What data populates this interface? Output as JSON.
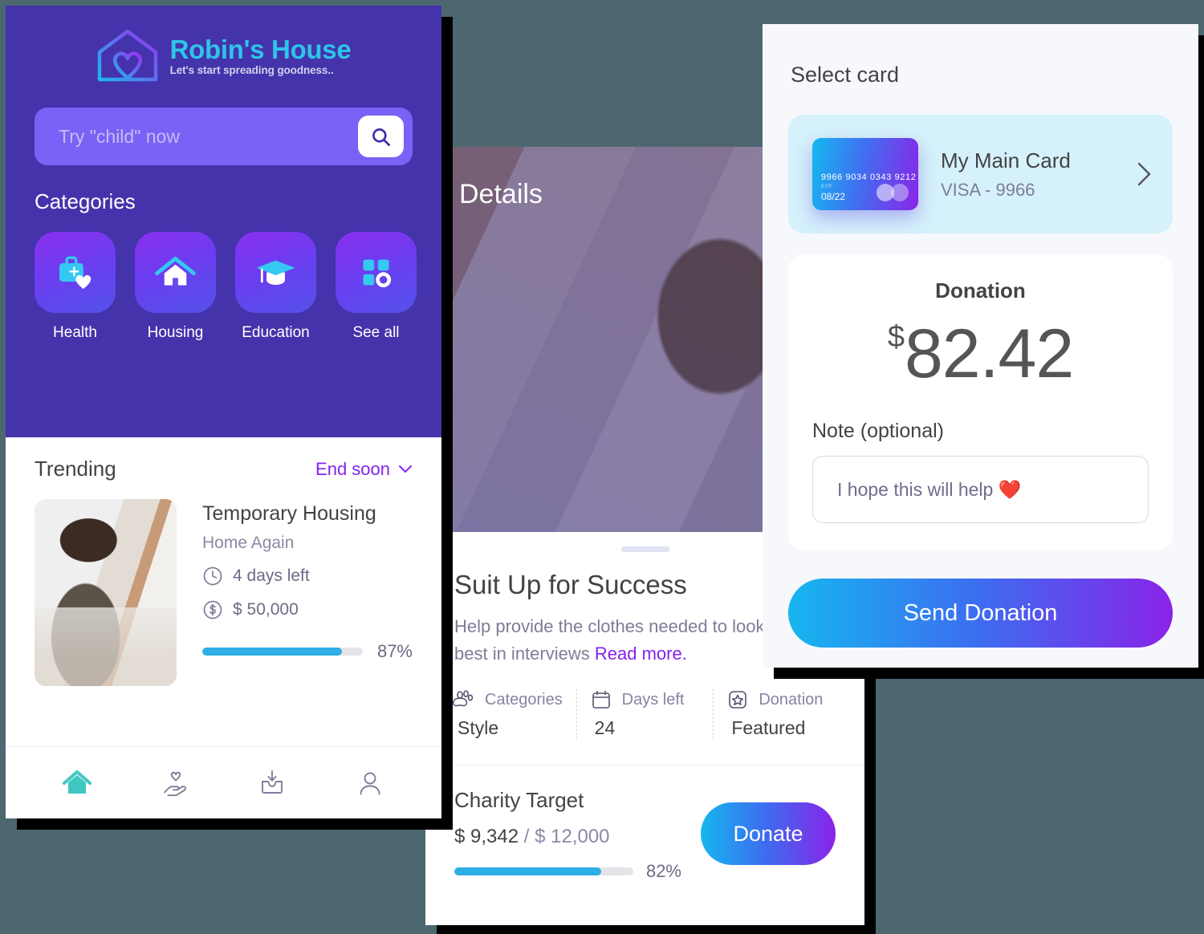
{
  "home": {
    "brand": {
      "title": "Robin's House",
      "tagline": "Let's start spreading goodness.."
    },
    "search": {
      "placeholder": "Try \"child\" now",
      "icon": "search-icon"
    },
    "categories_title": "Categories",
    "categories": [
      {
        "label": "Health",
        "icon": "medical-kit-heart-icon"
      },
      {
        "label": "Housing",
        "icon": "house-icon"
      },
      {
        "label": "Education",
        "icon": "graduation-cap-icon"
      },
      {
        "label": "See all",
        "icon": "grid-icon"
      }
    ],
    "trending": {
      "title": "Trending",
      "filter": "End soon",
      "item": {
        "name": "Temporary Housing",
        "org": "Home Again",
        "days_left": "4 days left",
        "amount": "$ 50,000",
        "progress_pct": 87,
        "progress_label": "87%"
      }
    },
    "tabs": [
      {
        "name": "home-tab",
        "icon": "home-icon",
        "active": true
      },
      {
        "name": "donate-tab",
        "icon": "hand-heart-icon",
        "active": false
      },
      {
        "name": "inbox-tab",
        "icon": "inbox-download-icon",
        "active": false
      },
      {
        "name": "profile-tab",
        "icon": "person-icon",
        "active": false
      }
    ]
  },
  "details": {
    "header_title": "Details",
    "title": "Suit Up for Success",
    "description": "Help provide the clothes needed to look their best in interviews",
    "read_more": "Read more.",
    "stats": [
      {
        "label": "Categories",
        "value": "Style",
        "icon": "paw-icon"
      },
      {
        "label": "Days left",
        "value": "24",
        "icon": "calendar-icon"
      },
      {
        "label": "Donation",
        "value": "Featured",
        "icon": "star-badge-icon"
      }
    ],
    "target": {
      "title": "Charity Target",
      "raised": "$ 9,342",
      "separator": "/",
      "goal": "$ 12,000",
      "progress_pct": 82,
      "progress_label": "82%",
      "donate_label": "Donate"
    }
  },
  "payment": {
    "select_card_title": "Select card",
    "card": {
      "name": "My Main Card",
      "subtitle": "VISA - 9966",
      "number": "9966 9034 0343 9212",
      "expiry_label": "EXP",
      "expiry": "08/22",
      "chevron": "chevron-right-icon"
    },
    "donation": {
      "label": "Donation",
      "currency": "$",
      "amount": "82.42"
    },
    "note": {
      "label": "Note (optional)",
      "value": "I hope this will help ❤️"
    },
    "submit_label": "Send Donation"
  },
  "colors": {
    "background": "#4d6771",
    "brand_purple": "#4433ab",
    "accent_cyan": "#2ec4e8",
    "accent_violet": "#8521f0",
    "progress_blue": "#2eaee6"
  }
}
